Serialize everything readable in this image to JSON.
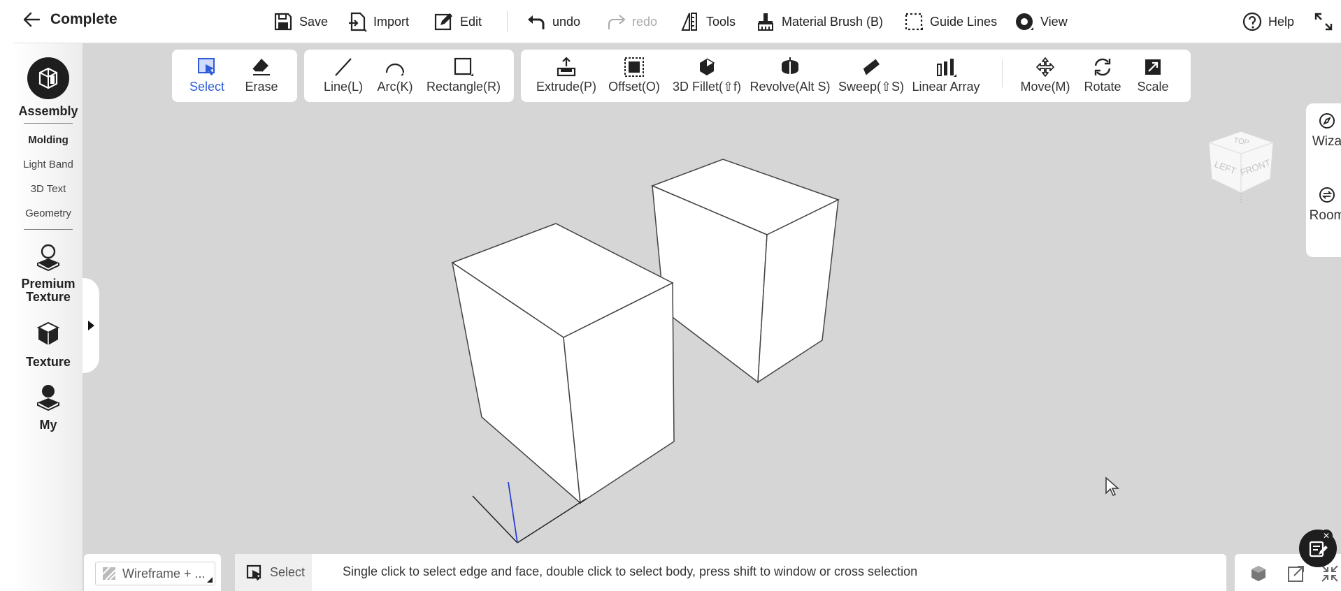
{
  "header": {
    "title": "Complete",
    "menu": [
      {
        "label": "Save",
        "icon": "save-icon"
      },
      {
        "label": "Import",
        "icon": "import-icon"
      },
      {
        "label": "Edit",
        "icon": "edit-icon"
      },
      {
        "label": "undo",
        "icon": "undo-icon"
      },
      {
        "label": "redo",
        "icon": "redo-icon",
        "disabled": true
      },
      {
        "label": "Tools",
        "icon": "tools-icon"
      },
      {
        "label": "Material Brush (B)",
        "icon": "brush-icon"
      },
      {
        "label": "Guide Lines",
        "icon": "guide-lines-icon"
      },
      {
        "label": "View",
        "icon": "view-icon"
      }
    ],
    "help_label": "Help"
  },
  "toolbar": {
    "select": "Select",
    "erase": "Erase",
    "line": "Line(L)",
    "arc": "Arc(K)",
    "rectangle": "Rectangle(R)",
    "extrude": "Extrude(P)",
    "offset": "Offset(O)",
    "fillet": "3D Fillet(⇧f)",
    "revolve": "Revolve(Alt S)",
    "sweep": "Sweep(⇧S)",
    "linear_array": "Linear Array",
    "move": "Move(M)",
    "rotate": "Rotate",
    "scale": "Scale"
  },
  "sidebar": {
    "assembly": "Assembly",
    "molding": "Molding",
    "light_band": "Light Band",
    "text_3d": "3D Text",
    "geometry": "Geometry",
    "premium_texture_1": "Premium",
    "premium_texture_2": "Texture",
    "texture": "Texture",
    "my": "My"
  },
  "right_panel": {
    "wizard": "Wiza",
    "room": "Room"
  },
  "viewcube": {
    "top": "TOP",
    "left": "LEFT",
    "front": "FRONT"
  },
  "bottom": {
    "render_mode": "Wireframe + ...",
    "current_tool": "Select",
    "hint": "Single click to select edge and face, double click to select body, press shift to window or cross selection"
  },
  "colors": {
    "accent": "#2f5cd6",
    "viewport_bg": "#d6d6d6",
    "axis_blue": "#2a3fd4"
  }
}
